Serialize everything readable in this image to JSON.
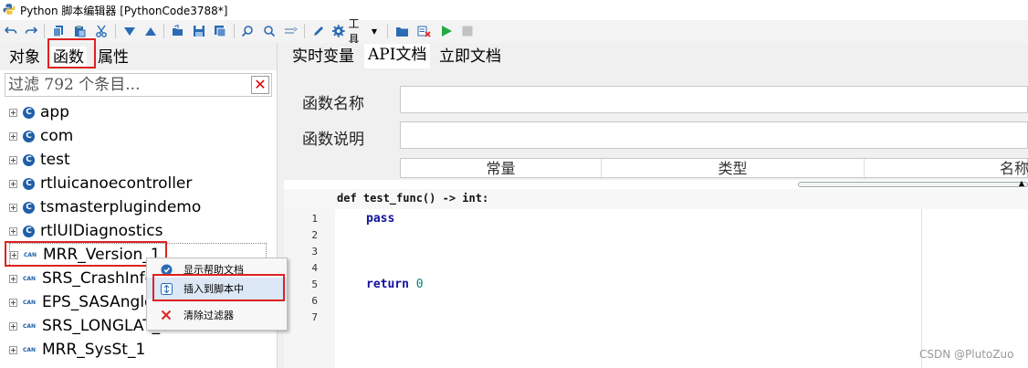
{
  "window": {
    "title": "Python 脚本编辑器 [PythonCode3788*]"
  },
  "toolbar": {
    "tools_label": "工具"
  },
  "left_tabs": [
    {
      "label": "对象"
    },
    {
      "label": "函数"
    },
    {
      "label": "属性"
    }
  ],
  "filter": {
    "placeholder": "过滤 792 个条目..."
  },
  "tree": {
    "items": [
      {
        "label": "app",
        "icon": "namespace-icon"
      },
      {
        "label": "com",
        "icon": "namespace-icon"
      },
      {
        "label": "test",
        "icon": "namespace-icon"
      },
      {
        "label": "rtluicanoecontroller",
        "icon": "namespace-icon"
      },
      {
        "label": "tsmasterplugindemo",
        "icon": "namespace-icon"
      },
      {
        "label": "rtlUIDiagnostics",
        "icon": "namespace-icon"
      },
      {
        "label": "MRR_Version_1",
        "icon": "can-icon",
        "can_text": "CAN"
      },
      {
        "label": "SRS_CrashInfo",
        "icon": "can-icon",
        "can_text": "CAN"
      },
      {
        "label": "EPS_SASAngle_",
        "icon": "can-icon",
        "can_text": "CAN"
      },
      {
        "label": "SRS_LONGLAT_",
        "icon": "can-icon",
        "can_text": "CAN"
      },
      {
        "label": "MRR_SysSt_1",
        "icon": "can-icon",
        "can_text": "CAN"
      }
    ]
  },
  "right_tabs": [
    {
      "label": "实时变量"
    },
    {
      "label": "API文档"
    },
    {
      "label": "立即文档"
    }
  ],
  "doc": {
    "func_name_label": "函数名称",
    "func_desc_label": "函数说明",
    "table_headers": [
      "常量",
      "类型",
      "名称"
    ]
  },
  "editor": {
    "signature": "def test_func() -> int:",
    "line_numbers": [
      "1",
      "2",
      "3",
      "4",
      "5",
      "6",
      "7"
    ],
    "line1_kw": "pass",
    "line5_kw": "return",
    "line5_num": "0"
  },
  "context_menu": {
    "items": [
      {
        "label": "显示帮助文档",
        "icon": "help-icon"
      },
      {
        "label": "插入到脚本中",
        "icon": "insert-icon"
      },
      {
        "label": "清除过滤器",
        "icon": "clear-filter-icon"
      }
    ]
  },
  "watermark": "CSDN @PlutoZuo",
  "colors": {
    "highlight_red": "#d22222",
    "brand_blue": "#1f5fa8",
    "run_green": "#22aa44"
  }
}
